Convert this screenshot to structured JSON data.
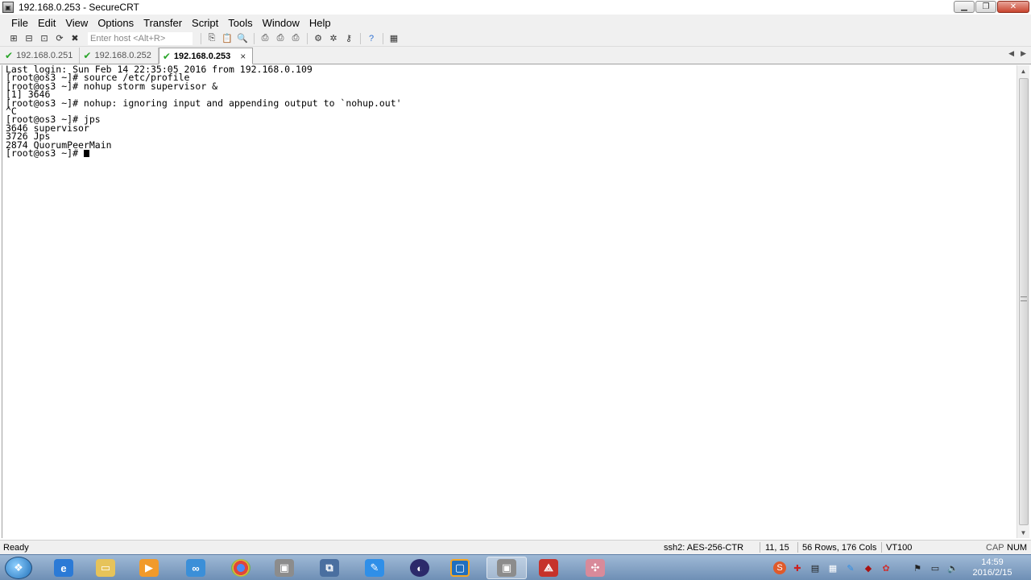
{
  "window": {
    "title": "192.168.0.253 - SecureCRT"
  },
  "menu": [
    "File",
    "Edit",
    "View",
    "Options",
    "Transfer",
    "Script",
    "Tools",
    "Window",
    "Help"
  ],
  "toolbar": {
    "host_placeholder": "Enter host <Alt+R>"
  },
  "tabs": [
    {
      "label": "192.168.0.251",
      "active": false
    },
    {
      "label": "192.168.0.252",
      "active": false
    },
    {
      "label": "192.168.0.253",
      "active": true
    }
  ],
  "tab_close_glyph": "×",
  "terminal": {
    "lines": [
      "Last login: Sun Feb 14 22:35:05 2016 from 192.168.0.109",
      "[root@os3 ~]# source /etc/profile",
      "[root@os3 ~]# nohup storm supervisor &",
      "[1] 3646",
      "[root@os3 ~]# nohup: ignoring input and appending output to `nohup.out'",
      "^C",
      "[root@os3 ~]# jps",
      "3646 supervisor",
      "3726 Jps",
      "2874 QuorumPeerMain",
      "[root@os3 ~]# "
    ]
  },
  "status": {
    "ready": "Ready",
    "cipher": "ssh2: AES-256-CTR",
    "cursor_pos": "11,  15",
    "size": "56 Rows, 176 Cols",
    "emulation": "VT100",
    "caps": "CAP",
    "num": "NUM"
  },
  "clock": {
    "time": "14:59",
    "date": "2016/2/15"
  },
  "colors": {
    "tab_check": "#2aa52a",
    "taskbar": "#6e8fb5"
  }
}
